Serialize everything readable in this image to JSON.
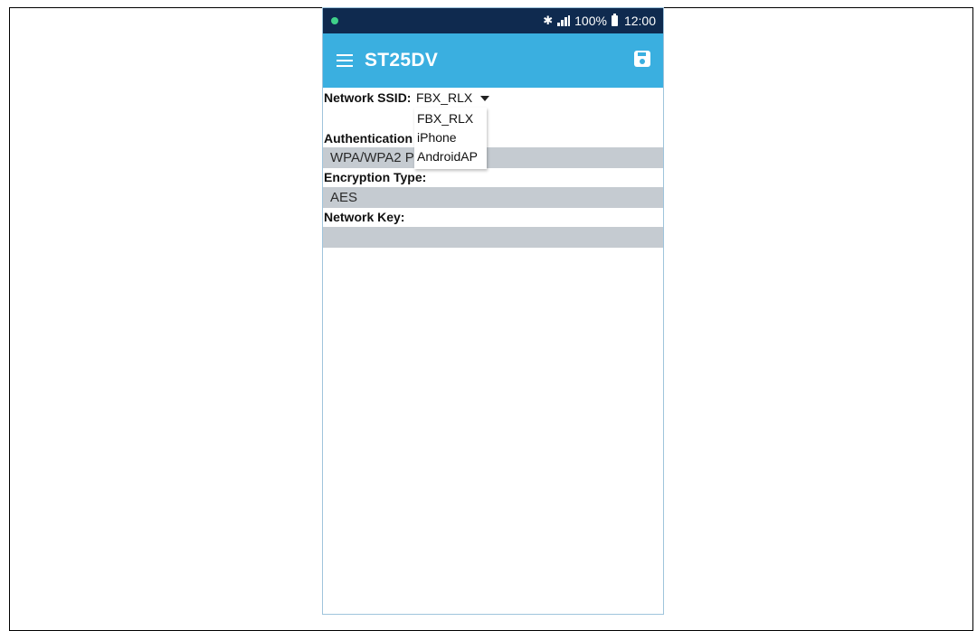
{
  "status_bar": {
    "bluetooth_icon": "bluetooth-icon",
    "signal_icon": "signal-icon",
    "battery_percent": "100%",
    "battery_icon": "battery-icon",
    "time": "12:00",
    "notification_dot_color": "#3fd18a"
  },
  "app_bar": {
    "menu_icon": "hamburger-menu-icon",
    "title": "ST25DV",
    "save_icon": "save-icon",
    "color": "#3aafe0"
  },
  "form": {
    "network_ssid": {
      "label": "Network SSID:",
      "selected": "FBX_RLX",
      "options": [
        "FBX_RLX",
        "iPhone",
        "AndroidAP"
      ]
    },
    "authentication_type": {
      "label": "Authentication Type:",
      "value": "WPA/WPA2 PSK"
    },
    "encryption_type": {
      "label": "Encryption Type:",
      "value": "AES"
    },
    "network_key": {
      "label": "Network Key:",
      "value": ""
    }
  }
}
